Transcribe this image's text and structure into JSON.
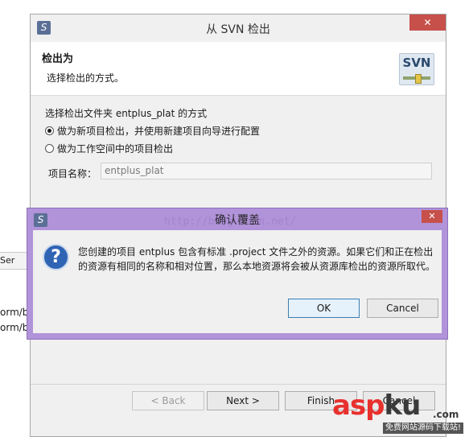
{
  "background": {
    "tab_label": "Ser",
    "lines": [
      "orm/b",
      "orm/b"
    ]
  },
  "svn_dialog": {
    "title": "从 SVN 检出",
    "close_glyph": "✕",
    "header_title": "检出为",
    "header_subtitle": "选择检出的方式。",
    "logo_text": "SVN",
    "section_label": "选择检出文件夹 entplus_plat 的方式",
    "option_new_project": "做为新项目检出，并使用新建项目向导进行配置",
    "option_workspace": "做为工作空间中的项目检出",
    "selected_option": "new_project",
    "project_name_label": "项目名称：",
    "project_name_value": "entplus_plat",
    "buttons": {
      "back": "< Back",
      "next": "Next >",
      "finish": "Finish",
      "cancel": "Cancel"
    }
  },
  "confirm_dialog": {
    "title": "确认覆盖",
    "close_glyph": "✕",
    "message": "您创建的项目 entplus 包含有标准 .project 文件之外的资源。如果它们和正在检出的资源有相同的名称和相对位置，那么本地资源将会被从资源库检出的资源所取代。",
    "ok_label": "OK",
    "cancel_label": "Cancel"
  },
  "watermark": {
    "url": "http://blog.csdn.net/",
    "logo_asp": "asp",
    "logo_ku": "ku",
    "logo_com": ".com",
    "logo_tagline": "免费网站源码下载站!"
  }
}
